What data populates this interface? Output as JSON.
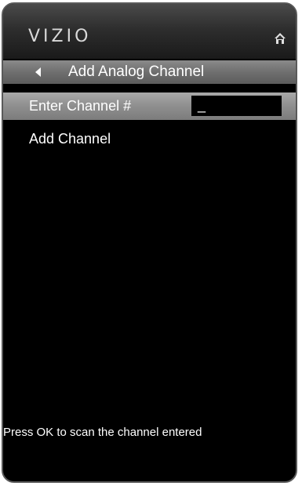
{
  "header": {
    "brand": "VIZIO",
    "home_icon": "home-icon"
  },
  "nav": {
    "back_icon": "back-arrow-icon",
    "title": "Add Analog Channel"
  },
  "menu": {
    "items": [
      {
        "label": "Enter Channel #",
        "selected": true,
        "input_value": "_"
      },
      {
        "label": "Add Channel",
        "selected": false
      }
    ]
  },
  "footer": {
    "hint": "Press OK to scan the channel entered"
  },
  "colors": {
    "background": "#000000",
    "header": "#2e2e2e",
    "nav_bar": "#6f6f6f",
    "selected_row": "#8e8e8e",
    "text": "#ffffff"
  }
}
